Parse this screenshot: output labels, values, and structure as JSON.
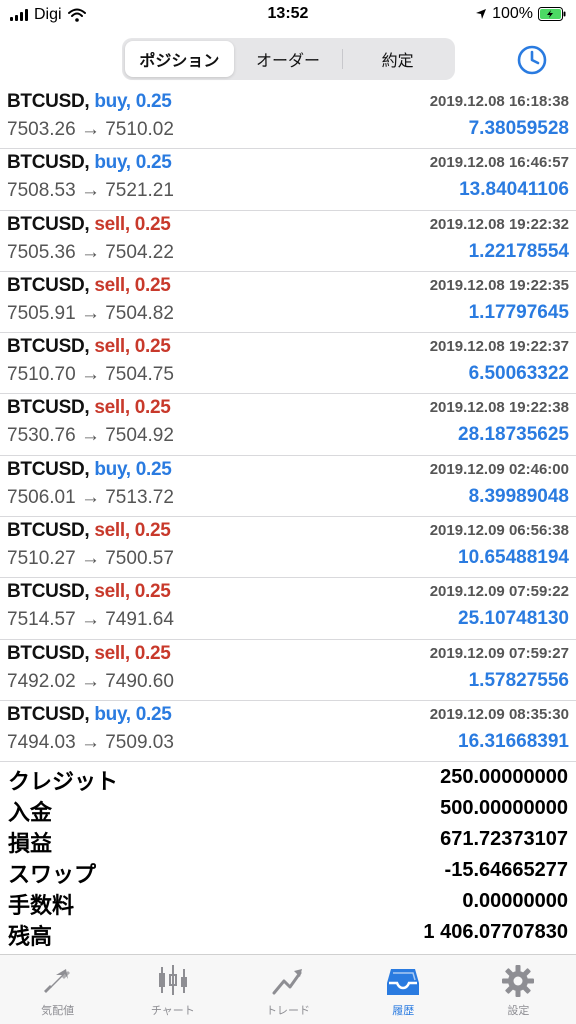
{
  "status": {
    "carrier": "Digi",
    "time": "13:52",
    "battery": "100%"
  },
  "header": {
    "tabs": [
      {
        "label": "ポジション",
        "active": true
      },
      {
        "label": "オーダー",
        "active": false
      },
      {
        "label": "約定",
        "active": false
      }
    ],
    "clock_icon": "clock-icon"
  },
  "colors": {
    "accent": "#2a7be0",
    "buy": "#2a7be0",
    "sell": "#c8392b"
  },
  "deals": [
    {
      "symbol": "BTCUSD,",
      "side": "buy, 0.25",
      "type": "buy",
      "time": "2019.12.08 16:18:38",
      "prices": "7503.26 → 7510.02",
      "profit": "7.38059528"
    },
    {
      "symbol": "BTCUSD,",
      "side": "buy, 0.25",
      "type": "buy",
      "time": "2019.12.08 16:46:57",
      "prices": "7508.53 → 7521.21",
      "profit": "13.84041106"
    },
    {
      "symbol": "BTCUSD,",
      "side": "sell, 0.25",
      "type": "sell",
      "time": "2019.12.08 19:22:32",
      "prices": "7505.36 → 7504.22",
      "profit": "1.22178554"
    },
    {
      "symbol": "BTCUSD,",
      "side": "sell, 0.25",
      "type": "sell",
      "time": "2019.12.08 19:22:35",
      "prices": "7505.91 → 7504.82",
      "profit": "1.17797645"
    },
    {
      "symbol": "BTCUSD,",
      "side": "sell, 0.25",
      "type": "sell",
      "time": "2019.12.08 19:22:37",
      "prices": "7510.70 → 7504.75",
      "profit": "6.50063322"
    },
    {
      "symbol": "BTCUSD,",
      "side": "sell, 0.25",
      "type": "sell",
      "time": "2019.12.08 19:22:38",
      "prices": "7530.76 → 7504.92",
      "profit": "28.18735625"
    },
    {
      "symbol": "BTCUSD,",
      "side": "buy, 0.25",
      "type": "buy",
      "time": "2019.12.09 02:46:00",
      "prices": "7506.01 → 7513.72",
      "profit": "8.39989048"
    },
    {
      "symbol": "BTCUSD,",
      "side": "sell, 0.25",
      "type": "sell",
      "time": "2019.12.09 06:56:38",
      "prices": "7510.27 → 7500.57",
      "profit": "10.65488194"
    },
    {
      "symbol": "BTCUSD,",
      "side": "sell, 0.25",
      "type": "sell",
      "time": "2019.12.09 07:59:22",
      "prices": "7514.57 → 7491.64",
      "profit": "25.10748130"
    },
    {
      "symbol": "BTCUSD,",
      "side": "sell, 0.25",
      "type": "sell",
      "time": "2019.12.09 07:59:27",
      "prices": "7492.02 → 7490.60",
      "profit": "1.57827556"
    },
    {
      "symbol": "BTCUSD,",
      "side": "buy, 0.25",
      "type": "buy",
      "time": "2019.12.09 08:35:30",
      "prices": "7494.03 → 7509.03",
      "profit": "16.31668391"
    }
  ],
  "summary": [
    {
      "label": "クレジット",
      "value": "250.00000000"
    },
    {
      "label": "入金",
      "value": "500.00000000"
    },
    {
      "label": "損益",
      "value": "671.72373107"
    },
    {
      "label": "スワップ",
      "value": "-15.64665277"
    },
    {
      "label": "手数料",
      "value": "0.00000000"
    },
    {
      "label": "残高",
      "value": "1 406.07707830"
    }
  ],
  "tabbar": [
    {
      "label": "気配値",
      "icon": "quotes-icon",
      "active": false
    },
    {
      "label": "チャート",
      "icon": "chart-icon",
      "active": false
    },
    {
      "label": "トレード",
      "icon": "trade-icon",
      "active": false
    },
    {
      "label": "履歴",
      "icon": "history-icon",
      "active": true
    },
    {
      "label": "設定",
      "icon": "settings-icon",
      "active": false
    }
  ]
}
